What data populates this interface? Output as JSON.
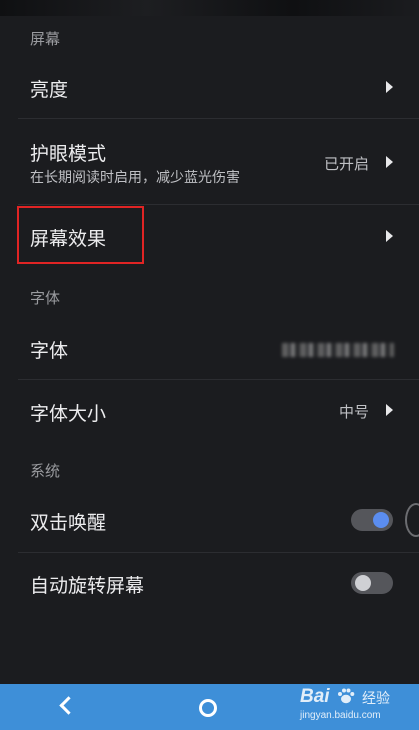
{
  "sections": {
    "screen": "屏幕",
    "font": "字体",
    "system": "系统"
  },
  "rows": {
    "brightness": {
      "label": "亮度"
    },
    "eye_care": {
      "label": "护眼模式",
      "subtitle": "在长期阅读时启用，减少蓝光伤害",
      "value": "已开启"
    },
    "screen_effect": {
      "label": "屏幕效果"
    },
    "font": {
      "label": "字体"
    },
    "font_size": {
      "label": "字体大小",
      "value": "中号"
    },
    "double_tap_wake": {
      "label": "双击唤醒",
      "enabled": true
    },
    "auto_rotate": {
      "label": "自动旋转屏幕",
      "enabled": false
    }
  },
  "colors": {
    "background": "#1b1c1f",
    "highlight": "#e02424",
    "toggle_on": "#5b8def",
    "navbar": "#3e8fd8"
  },
  "watermark": {
    "brand": "Bai",
    "brand_suffix": "经验",
    "url": "jingyan.baidu.com"
  }
}
